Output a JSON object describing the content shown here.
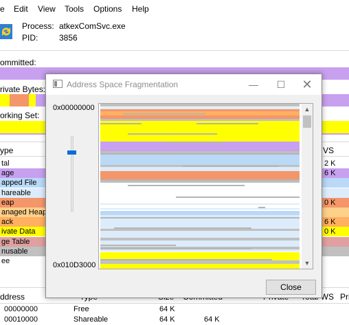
{
  "menu": [
    "e",
    "Edit",
    "View",
    "Tools",
    "Options",
    "Help"
  ],
  "process": {
    "process_label": "Process:",
    "process_value": "atkexComSvc.exe",
    "pid_label": "PID:",
    "pid_value": "3856"
  },
  "graphs": {
    "committed_label": "ommitted:",
    "private_bytes_label": "rivate Bytes:",
    "working_set_label": "orking Set:"
  },
  "type_table": {
    "header_type": "ype",
    "header_ws": "VS",
    "rows": [
      {
        "label": "tal",
        "value": "2 K",
        "color": "#ffffff"
      },
      {
        "label": "age",
        "value": "6 K",
        "color": "#c8a0f0"
      },
      {
        "label": "apped File",
        "value": "",
        "color": "#b9d9f7"
      },
      {
        "label": "hareable",
        "value": "",
        "color": "#dcecfb"
      },
      {
        "label": "eap",
        "value": "0 K",
        "color": "#f4966a"
      },
      {
        "label": "anaged Heap",
        "value": "",
        "color": "#ffd08a"
      },
      {
        "label": "ack",
        "value": "6 K",
        "color": "#ffb060"
      },
      {
        "label": "ivate Data",
        "value": "0 K",
        "color": "#ffff00"
      },
      {
        "label": "ge Table",
        "value": "",
        "color": "#e0a0a0"
      },
      {
        "label": "nusable",
        "value": "",
        "color": "#c0c0c0"
      },
      {
        "label": "ee",
        "value": "",
        "color": "#ffffff"
      }
    ]
  },
  "detail_table": {
    "headers": {
      "address": "ddress",
      "type": "Type",
      "size": "Size",
      "committed": "Committed",
      "private": "Private",
      "total_ws": "Total WS",
      "pri": "Pri"
    },
    "rows": [
      {
        "address": "00000000",
        "type": "Free",
        "size": "64 K",
        "committed": ""
      },
      {
        "address": "00010000",
        "type": "Shareable",
        "size": "64 K",
        "committed": "64 K"
      }
    ]
  },
  "dialog": {
    "title": "Address Space Fragmentation",
    "addr_top": "0x00000000",
    "addr_bottom": "0x010D3000",
    "close_label": "Close",
    "slider_position_fraction": 0.2
  },
  "colors": {
    "image": "#c8a0f0",
    "mapped_file": "#b9d9f7",
    "shareable": "#dcecfb",
    "heap": "#f4966a",
    "stack": "#ffb060",
    "private_data": "#ffff00",
    "unusable": "#c0c0c0",
    "accent": "#0a6cd6"
  },
  "icons": {
    "app": "procexp-refresh-icon",
    "minimize": "minimize-icon",
    "maximize": "maximize-icon",
    "close": "close-icon"
  }
}
